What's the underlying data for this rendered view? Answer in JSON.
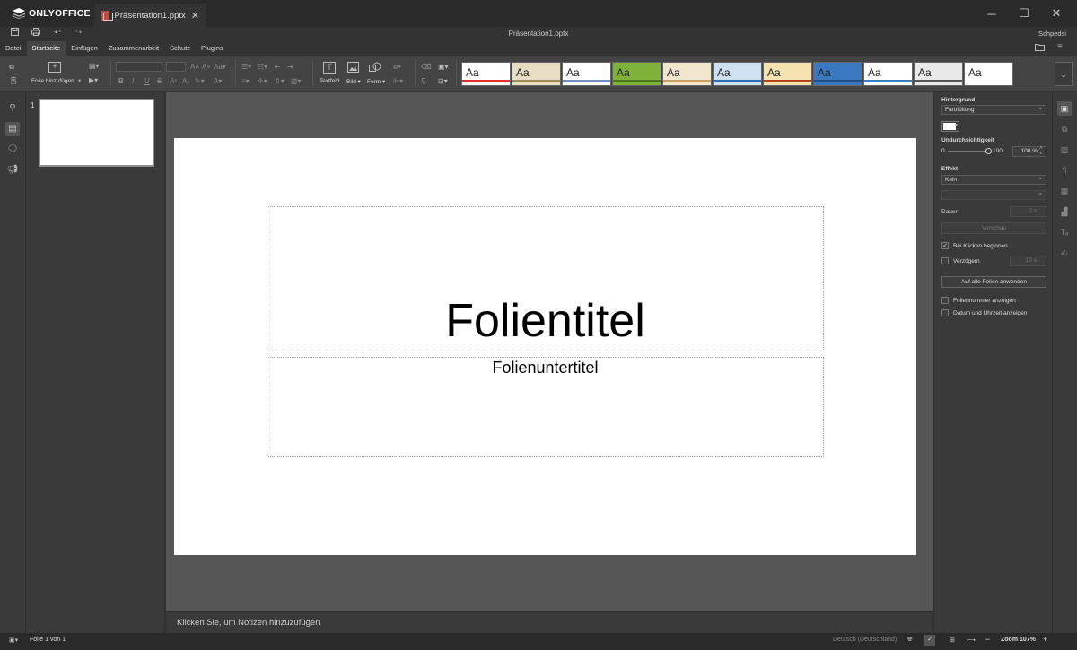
{
  "app": {
    "name": "ONLYOFFICE"
  },
  "tab": {
    "doc_name": "Präsentation1.pptx",
    "close_icon": "close-icon"
  },
  "window": {
    "minimize": "─",
    "maximize": "☐",
    "close": "✕"
  },
  "header": {
    "title": "Präsentation1.pptx",
    "user": "Schpedsi"
  },
  "menu": {
    "tabs": [
      "Datei",
      "Startseite",
      "Einfügen",
      "Zusammenarbeit",
      "Schutz",
      "Plugins"
    ],
    "active": "Startseite"
  },
  "toolbar": {
    "add_slide": "Folie hinzufügen",
    "textfield": "Textfeld",
    "image": "Bild",
    "shape": "Form",
    "font_value": "",
    "size_value": ""
  },
  "themes": [
    {
      "label": "Aa",
      "bg": "#ffffff",
      "accent": "#e52f2f"
    },
    {
      "label": "Aa",
      "bg": "#e8dcc2",
      "accent": "#a08a60"
    },
    {
      "label": "Aa",
      "bg": "#ffffff",
      "accent": "#6d8fc7"
    },
    {
      "label": "Aa",
      "bg": "#7fb23a",
      "accent": "#4b7a1e"
    },
    {
      "label": "Aa",
      "bg": "#f3e6cf",
      "accent": "#c9a06a"
    },
    {
      "label": "Aa",
      "bg": "#cfe0f0",
      "accent": "#2c6fb3"
    },
    {
      "label": "Aa",
      "bg": "#f4e3b0",
      "accent": "#b04020"
    },
    {
      "label": "Aa",
      "bg": "#3b78c2",
      "accent": "#1d4f8a"
    },
    {
      "label": "Aa",
      "bg": "#ffffff",
      "accent": "#3d7fc4"
    },
    {
      "label": "Aa",
      "bg": "#e9e9e9",
      "accent": "#555555"
    },
    {
      "label": "Aa",
      "bg": "#ffffff",
      "accent": "#ffffff"
    }
  ],
  "slides": {
    "thumb_number": "1"
  },
  "slide": {
    "title": "Folientitel",
    "subtitle": "Folienuntertitel"
  },
  "notes": {
    "placeholder": "Klicken Sie, um Notizen hinzuzufügen"
  },
  "panel": {
    "background_label": "Hintergrund",
    "fill_value": "Farbfüllung",
    "fill_color": "#ffffff",
    "opacity_label": "Undurchsichtigkeit",
    "opacity_min": "0",
    "opacity_max": "100",
    "opacity_value": "100 %",
    "opacity_level": 1.0,
    "effect_label": "Effekt",
    "effect_value": "Kein",
    "effect_sub_value": "",
    "duration_label": "Dauer",
    "duration_value": "2 s",
    "preview_button": "Vorschau",
    "on_click_label": "Bei Klicken beginnen",
    "on_click_checked": true,
    "delay_label": "Verzögern",
    "delay_value": "10 s",
    "apply_all_button": "Auf alle Folien anwenden",
    "slide_number_label": "Foliennummer anzeigen",
    "date_time_label": "Datum und Uhrzeit anzeigen"
  },
  "status": {
    "slide_info": "Folie 1 von 1",
    "language": "Deutsch (Deutschland)",
    "zoom": "Zoom 107%",
    "zoom_minus": "−",
    "zoom_plus": "+"
  }
}
